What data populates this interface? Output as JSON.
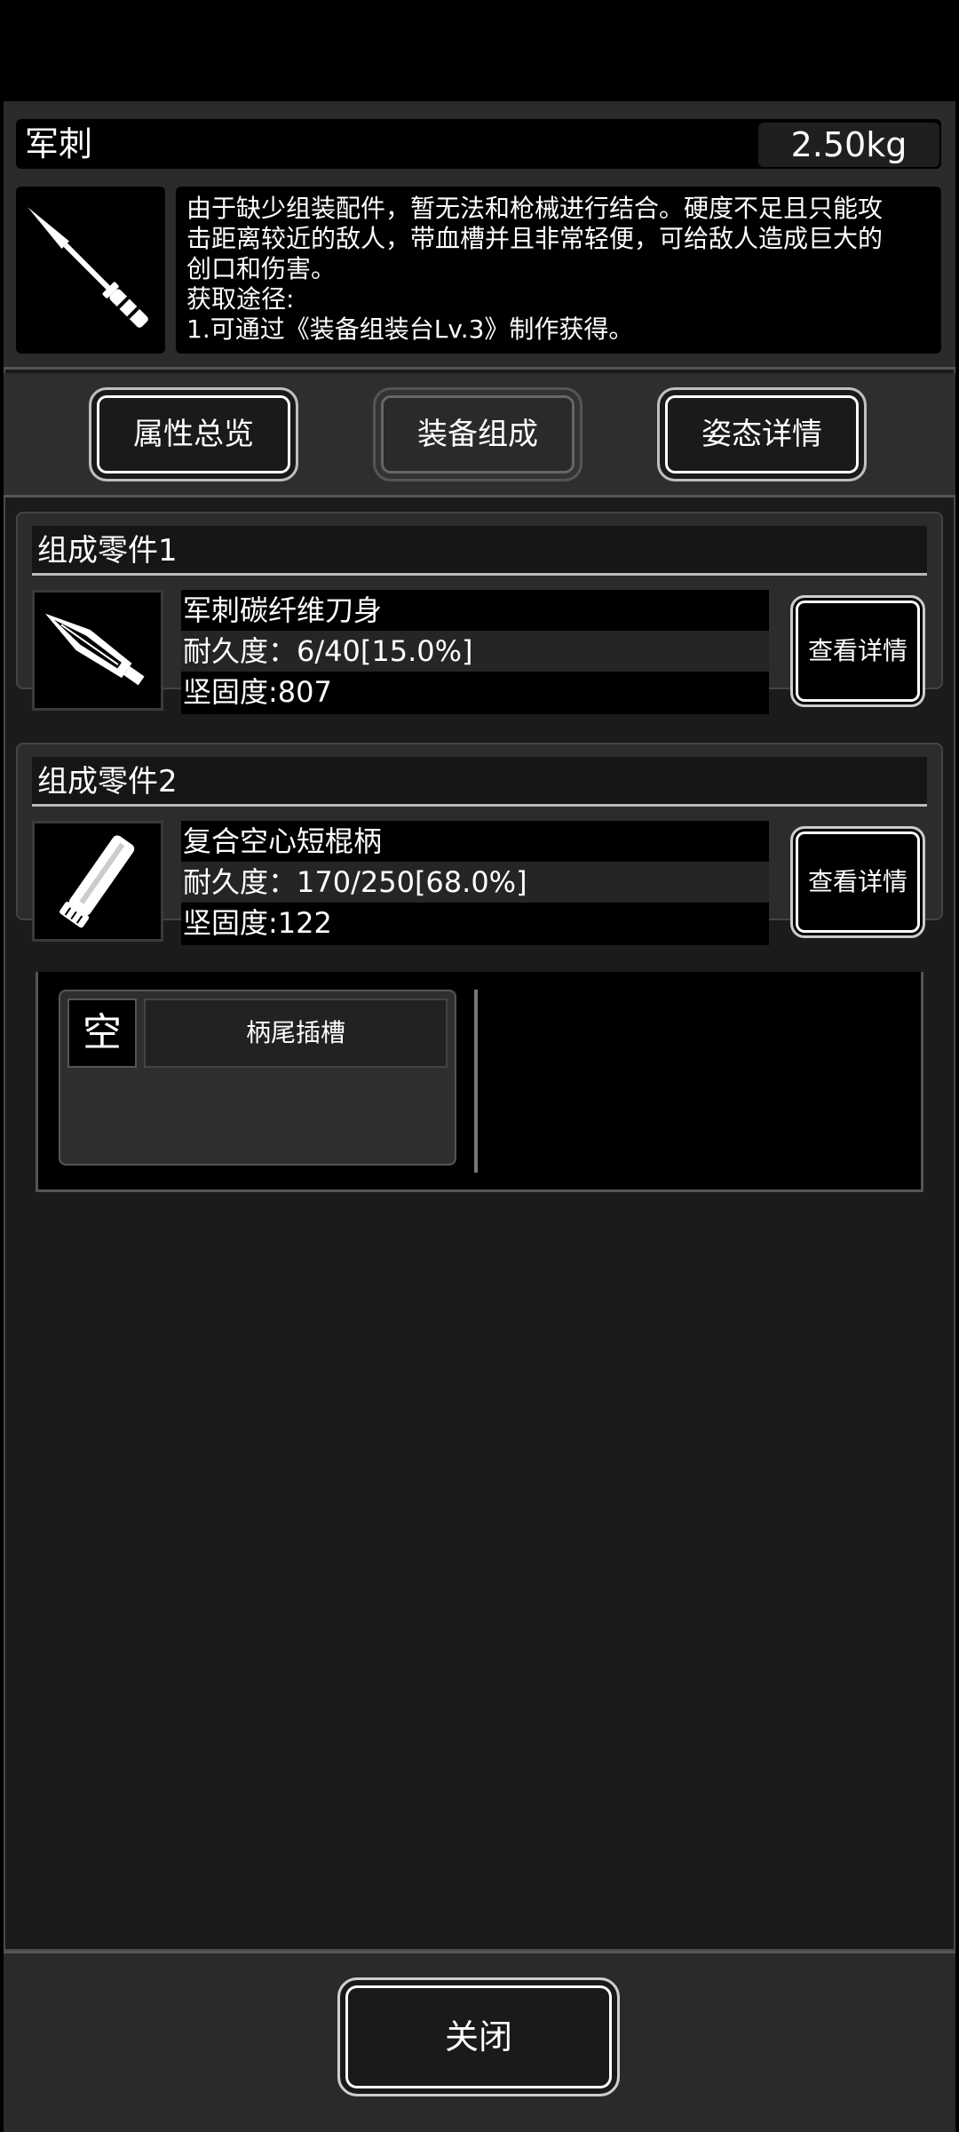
{
  "item": {
    "name": "军刺",
    "weight": "2.50kg",
    "description_lines": [
      "由于缺少组装配件，暂无法和枪械进行结合。硬度不足且只能攻",
      "击距离较近的敌人，带血槽并且非常轻便，可给敌人造成巨大的",
      "创口和伤害。",
      "获取途径:",
      "1.可通过《装备组装台Lv.3》制作获得。"
    ],
    "icon": "bayonet-icon"
  },
  "tabs": {
    "overview": "属性总览",
    "composition": "装备组成",
    "stance": "姿态详情",
    "active": "composition"
  },
  "parts": [
    {
      "header": "组成零件1",
      "name": "军刺碳纤维刀身",
      "durability": "耐久度：6/40[15.0%]",
      "hardness": "坚固度:807",
      "icon": "blade-icon",
      "button": "查看详情"
    },
    {
      "header": "组成零件2",
      "name": "复合空心短棍柄",
      "durability": "耐久度：170/250[68.0%]",
      "hardness": "坚固度:122",
      "icon": "handle-icon",
      "button": "查看详情"
    }
  ],
  "slot": {
    "status": "空",
    "label": "柄尾插槽"
  },
  "footer": {
    "close_label": "关闭"
  }
}
